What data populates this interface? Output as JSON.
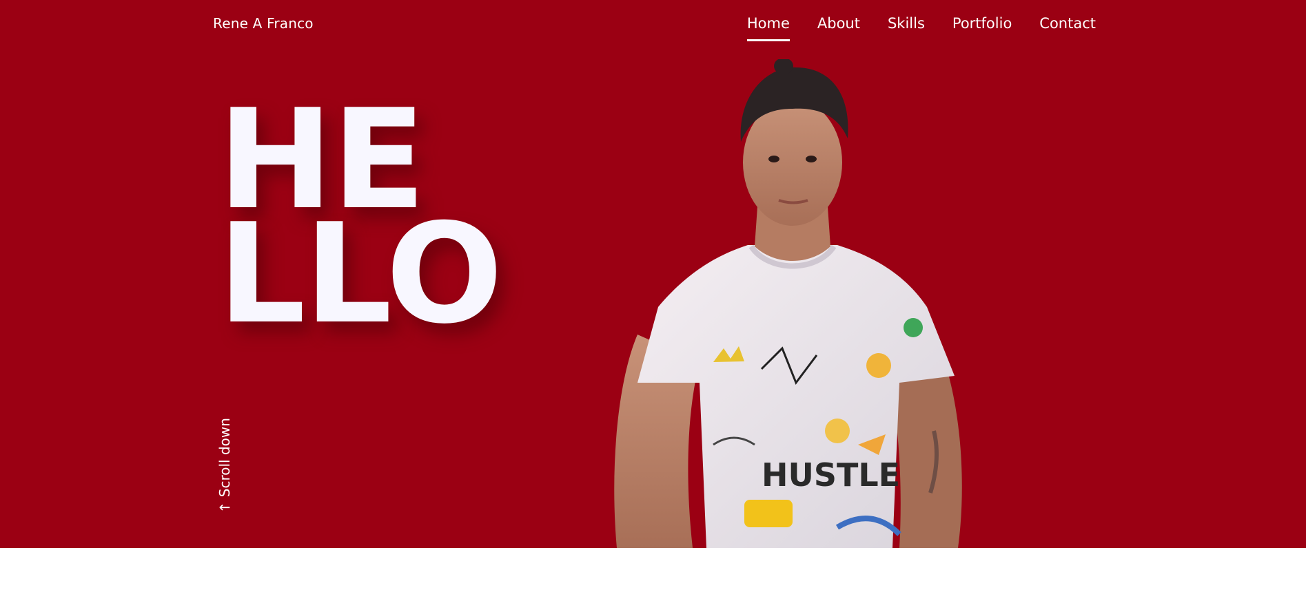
{
  "header": {
    "brand": "Rene A Franco",
    "nav": [
      {
        "label": "Home",
        "active": true
      },
      {
        "label": "About",
        "active": false
      },
      {
        "label": "Skills",
        "active": false
      },
      {
        "label": "Portfolio",
        "active": false
      },
      {
        "label": "Contact",
        "active": false
      }
    ]
  },
  "hero": {
    "line1": "HE",
    "line2": "LLO",
    "scroll_label": "Scroll down",
    "scroll_icon": "arrow-down-icon",
    "portrait_alt": "portrait-photo"
  },
  "colors": {
    "hero_bg": "#9b0013",
    "text": "#ffffff",
    "hello_text": "#f8f7ff"
  }
}
